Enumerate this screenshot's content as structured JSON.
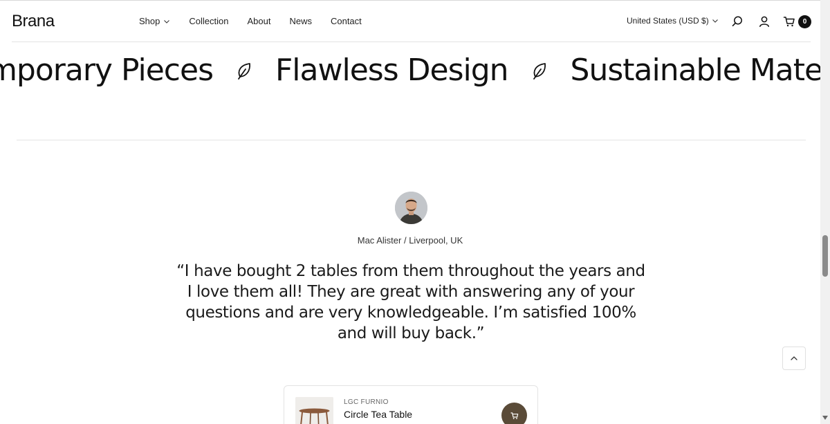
{
  "brand": {
    "logo": "Brana"
  },
  "nav": {
    "items": [
      {
        "label": "Shop",
        "has_dropdown": true
      },
      {
        "label": "Collection"
      },
      {
        "label": "About"
      },
      {
        "label": "News"
      },
      {
        "label": "Contact"
      }
    ]
  },
  "header": {
    "currency": "United States (USD $)",
    "cart_count": "0",
    "icons": [
      "search-icon",
      "account-icon",
      "cart-icon"
    ]
  },
  "marquee": {
    "items": [
      "emporary Pieces",
      "Flawless Design",
      "Sustainable Materials"
    ],
    "separator_icon": "leaf-icon"
  },
  "testimonial": {
    "author": "Mac Alister",
    "separator": "/",
    "location": "Liverpool, UK",
    "quote": "“I have bought 2 tables from them throughout the years and I love them all! They are great with answering any of your questions and are very knowledgeable. I’m satisfied 100% and will buy back.”"
  },
  "product": {
    "brand": "LGC FURNIO",
    "name": "Circle Tea Table",
    "cart_icon": "cart-icon"
  },
  "colors": {
    "accent": "#5a4b38",
    "text": "#1a1a1a",
    "badge": "#111111"
  }
}
